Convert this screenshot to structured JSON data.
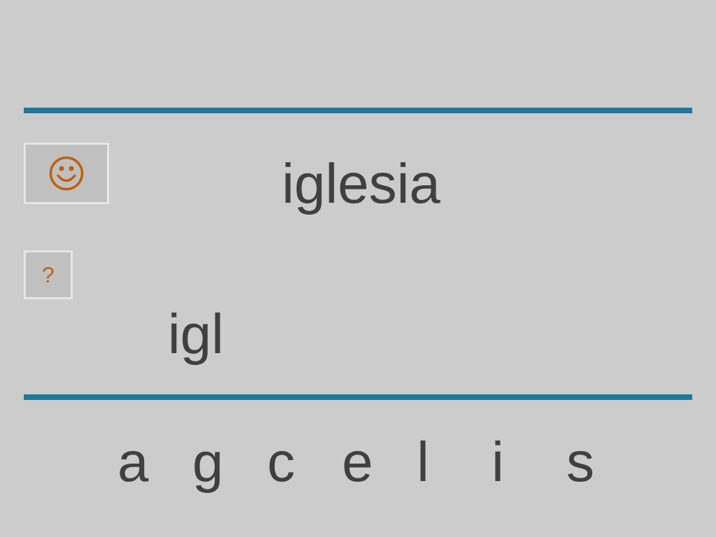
{
  "word": "iglesia",
  "help_button": {
    "label": "?"
  },
  "answer": "igl",
  "letters": [
    "a",
    "g",
    "c",
    "e",
    "l",
    "i",
    "s"
  ]
}
